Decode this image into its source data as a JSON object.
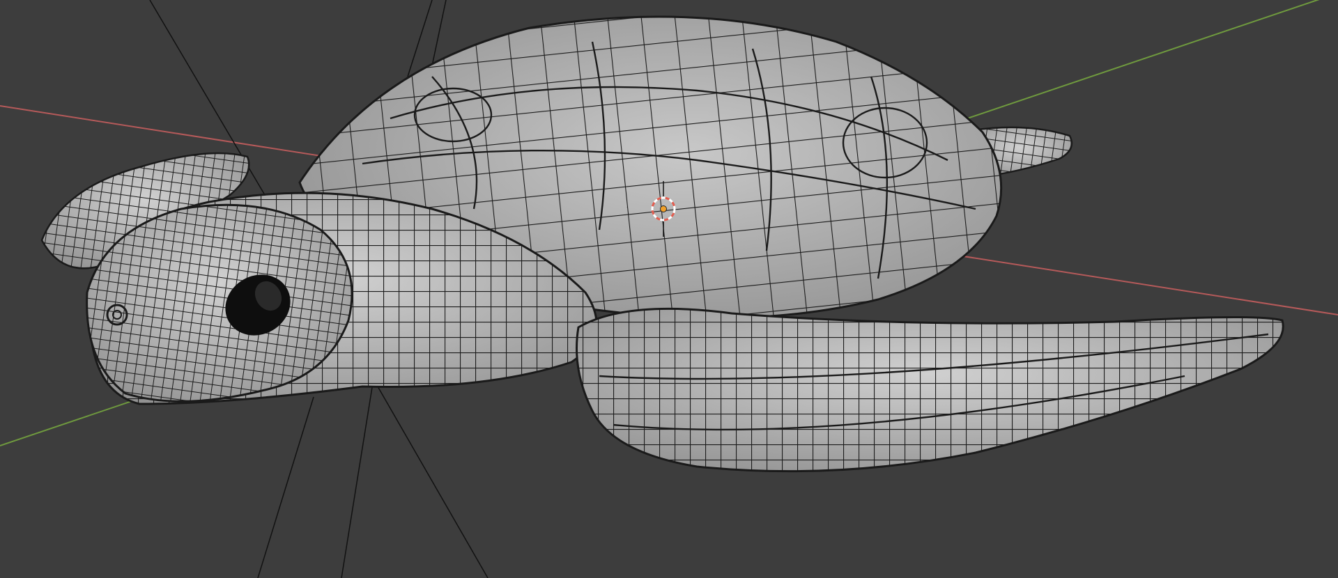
{
  "viewport": {
    "mode": "edit-mode-wireframe-overlay",
    "background_color": "#3d3d3d",
    "axis_colors": {
      "x": "#b65a5a",
      "y": "#6f9a3e"
    },
    "mesh": {
      "name_semantic": "sea-turtle-mesh",
      "surface_color": "#b9b9b9",
      "wire_color": "#1a1a1a"
    },
    "cursor": {
      "icon": "3d-cursor-icon",
      "ring_color": "#e35d4f",
      "origin_color": "#f0a02a"
    }
  },
  "theme": {
    "accent": "#f0a02a"
  }
}
